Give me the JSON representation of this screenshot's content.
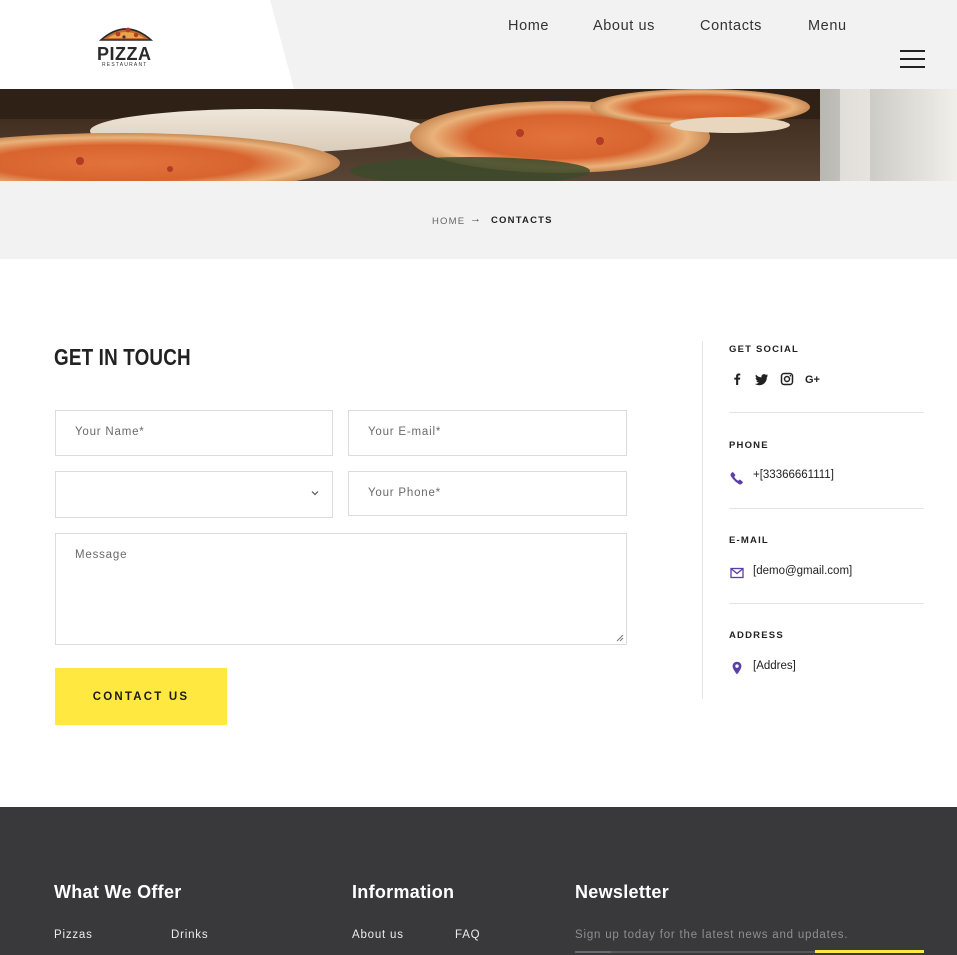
{
  "brand": {
    "name": "PIZZA",
    "tagline": "RESTAURANT"
  },
  "nav": {
    "items": [
      "Home",
      "About us",
      "Contacts",
      "Menu"
    ]
  },
  "breadcrumb": {
    "home": "HOME",
    "current": "CONTACTS"
  },
  "contact_form": {
    "title": "GET IN TOUCH",
    "name_placeholder": "Your Name*",
    "email_placeholder": "Your E-mail*",
    "select_value": "",
    "phone_placeholder": "Your Phone*",
    "message_placeholder": "Message",
    "submit_label": "CONTACT US"
  },
  "sidebar": {
    "social_heading": "GET SOCIAL",
    "social_icons": [
      "facebook-icon",
      "twitter-icon",
      "instagram-icon",
      "google-plus-icon"
    ],
    "phone_heading": "PHONE",
    "phone_value": "+[33366661111]",
    "email_heading": "E-MAIL",
    "email_value": "[demo@gmail.com]",
    "address_heading": "ADDRESS",
    "address_value": "[Addres]"
  },
  "footer": {
    "col1_title": "What We Offer",
    "col1_links": [
      "Pizzas",
      "Drinks"
    ],
    "col2_title": "Information",
    "col2_links": [
      "About us",
      "FAQ"
    ],
    "col3_title": "Newsletter",
    "newsletter_text": "Sign up today for the latest news and updates."
  },
  "colors": {
    "accent": "#ffe840",
    "icon_purple": "#5b3fa8",
    "footer_bg": "#39393b",
    "header_bg": "#f2f2f2"
  }
}
